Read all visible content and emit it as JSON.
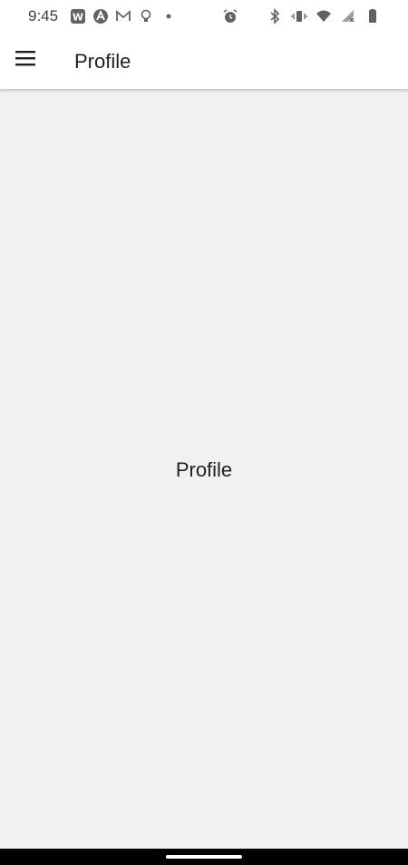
{
  "status_bar": {
    "time": "9:45",
    "left_icons": [
      "w-app-icon",
      "a-app-icon",
      "gmail-icon",
      "lightbulb-icon",
      "dot-icon"
    ],
    "right_icons": [
      "alarm-icon",
      "bluetooth-icon",
      "vibrate-icon",
      "wifi-icon",
      "cellular-no-signal-icon",
      "battery-icon"
    ]
  },
  "app_bar": {
    "title": "Profile",
    "menu_icon": "hamburger-menu-icon"
  },
  "content": {
    "center_text": "Profile"
  },
  "colors": {
    "background": "#f1f1f1",
    "app_bar": "#ffffff",
    "text": "#212121",
    "nav_bar": "#000000"
  }
}
